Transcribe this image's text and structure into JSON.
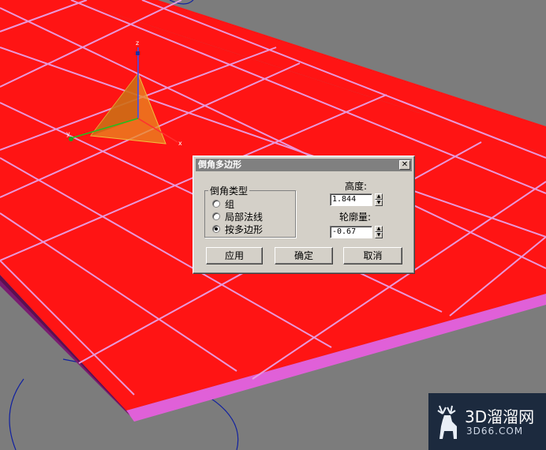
{
  "dialog": {
    "title": "倒角多边形",
    "close_glyph": "✕",
    "group_label": "倒角类型",
    "options": [
      {
        "label": "组",
        "selected": false
      },
      {
        "label": "局部法线",
        "selected": false
      },
      {
        "label": "按多边形",
        "selected": true
      }
    ],
    "height_label": "高度:",
    "height_value": "1.844",
    "outline_label": "轮廓量:",
    "outline_value": "-0.67",
    "apply_label": "应用",
    "ok_label": "确定",
    "cancel_label": "取消"
  },
  "gizmo": {
    "axis_z": "z",
    "axis_x": "x",
    "axis_y": "y"
  },
  "watermark": {
    "text": "3D溜溜网",
    "sub": "3D66.COM"
  },
  "colors": {
    "mesh": "#ff1414",
    "edge": "#e87ad8",
    "side": "#c850c0",
    "viewport_bg": "#7c7c7c",
    "dialog_bg": "#d4d0c8"
  }
}
